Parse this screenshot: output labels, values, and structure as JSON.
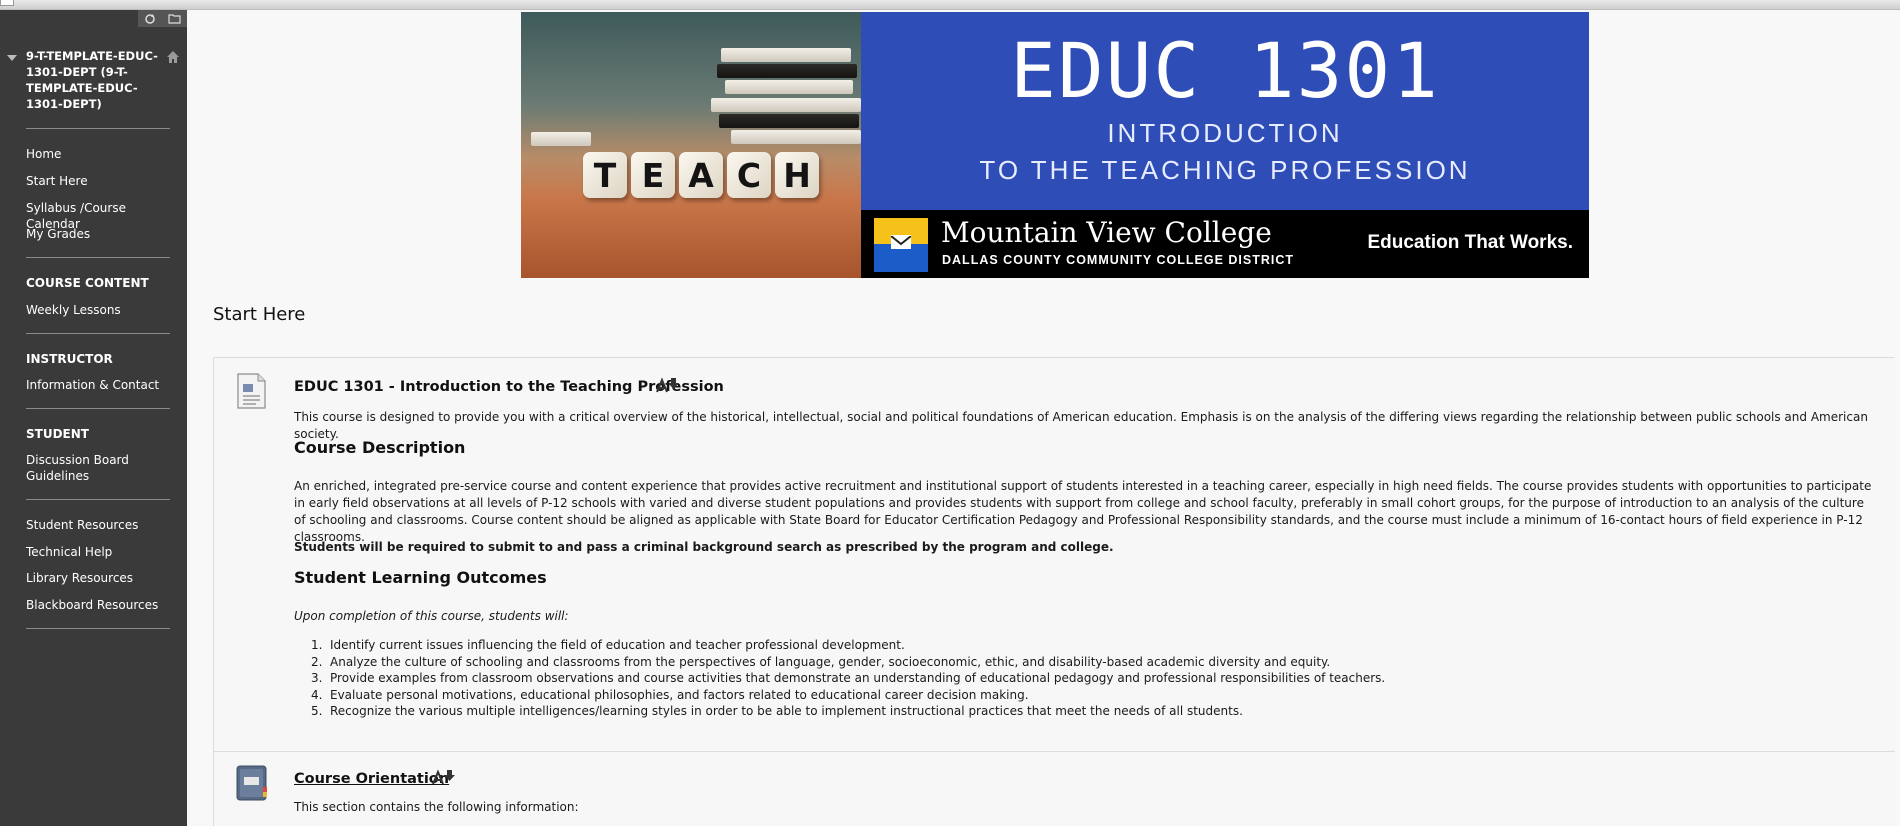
{
  "sidebar": {
    "course_title": "9-T-TEMPLATE-EDUC-1301-DEPT (9-T-TEMPLATE-EDUC-1301-DEPT)",
    "nav": [
      {
        "label": "Home"
      },
      {
        "label": "Start Here"
      },
      {
        "label": "Syllabus /Course Calendar"
      },
      {
        "label": "My Grades"
      }
    ],
    "section_course_content": {
      "heading": "COURSE CONTENT",
      "items": [
        {
          "label": "Weekly Lessons"
        }
      ]
    },
    "section_instructor": {
      "heading": "INSTRUCTOR",
      "items": [
        {
          "label": "Information & Contact"
        }
      ]
    },
    "section_student": {
      "heading": "STUDENT",
      "items": [
        {
          "label": "Discussion Board Guidelines"
        }
      ]
    },
    "resources": [
      {
        "label": "Student Resources"
      },
      {
        "label": "Technical Help"
      },
      {
        "label": "Library Resources"
      },
      {
        "label": "Blackboard Resources"
      }
    ]
  },
  "banner": {
    "dice_letters": [
      "T",
      "E",
      "A",
      "C",
      "H"
    ],
    "course_code": "EDUC 1301",
    "subtitle_line1": "INTRODUCTION",
    "subtitle_line2": "TO THE TEACHING PROFESSION",
    "college_name": "Mountain View College",
    "district": "DALLAS COUNTY COMMUNITY COLLEGE DISTRICT",
    "tagline": "Education That Works.",
    "colors": {
      "blue": "#2f4db6",
      "black": "#000000",
      "logo_yellow": "#f6c21a"
    }
  },
  "page": {
    "title": "Start Here"
  },
  "items": {
    "intro": {
      "title": "EDUC 1301 - Introduction to the Teaching Profession",
      "summary": "This course is designed to provide you with a critical overview of the historical, intellectual, social and political foundations of American education. Emphasis is on the analysis of the differing views regarding the relationship between public schools and American society.",
      "desc_heading": "Course Description",
      "description": "An enriched, integrated pre-service course and content experience that provides active recruitment and institutional support of students interested in a teaching career, especially in high need fields. The course provides students with opportunities to participate in early field observations at all levels of P-12 schools with varied and diverse student populations and provides students with support from college and school faculty, preferably in small cohort groups, for the purpose of introduction to an analysis of the culture of schooling and classrooms. Course content should be aligned as applicable with State Board for Educator Certification Pedagogy and Professional Responsibility standards, and the course must include a minimum of 16-contact hours of field experience in P-12 classrooms.",
      "requirement": "Students will be required to submit to and pass a criminal background search as prescribed by the program and college.",
      "outcomes_heading": "Student Learning Outcomes",
      "outcomes_intro": "Upon completion of this course, students will:",
      "outcomes": [
        {
          "num": "1.",
          "text": "Identify current issues influencing the field of education and teacher professional development."
        },
        {
          "num": "2.",
          "text": "Analyze the culture of schooling and classrooms from the perspectives of language, gender, socioeconomic, ethic, and disability-based academic diversity and equity."
        },
        {
          "num": "3.",
          "text": "Provide examples from classroom observations and course activities that demonstrate an understanding of educational pedagogy and professional responsibilities of teachers."
        },
        {
          "num": "4.",
          "text": "Evaluate personal motivations, educational philosophies, and factors related to educational career decision making."
        },
        {
          "num": "5.",
          "text": "Recognize the various multiple intelligences/learning styles in order to be able to implement instructional practices that meet the needs of all students."
        }
      ]
    },
    "orientation": {
      "title": "Course Orientation",
      "summary": "This section contains the following information:"
    }
  }
}
